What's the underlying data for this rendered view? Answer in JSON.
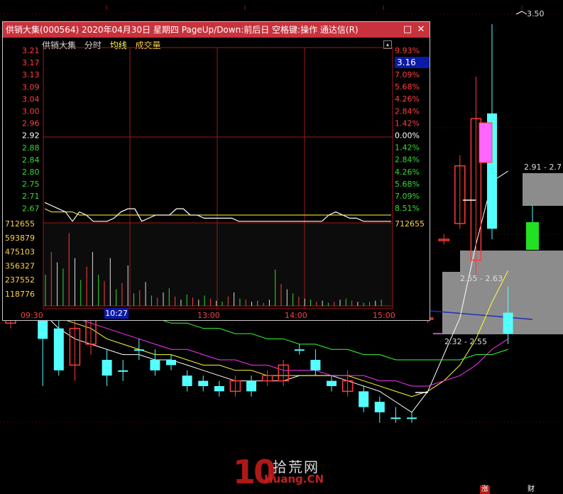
{
  "window": {
    "title": "供销大集(000564) 2020年04月30日 星期四 PageUp/Down:前后日 空格键:操作 通达信(R)",
    "restore_glyph": "□",
    "close_glyph": "✕"
  },
  "menu": {
    "stock_name": "供销大集",
    "items": [
      "分时",
      "均线",
      "成交量"
    ]
  },
  "intraday": {
    "price_labels_left": [
      "3.21",
      "3.17",
      "3.13",
      "3.09",
      "3.04",
      "3.00",
      "2.96",
      "2.92",
      "2.88",
      "2.84",
      "2.80",
      "2.75",
      "2.71",
      "2.67"
    ],
    "pct_labels_right": [
      "9.93%",
      "7.09%",
      "5.68%",
      "4.26%",
      "2.84%",
      "1.42%",
      "0.00%",
      "1.42%",
      "2.84%",
      "4.26%",
      "5.68%",
      "7.09%",
      "8.51%"
    ],
    "volume_labels": [
      "712655",
      "593879",
      "475103",
      "356327",
      "237552",
      "118776"
    ],
    "volume_label_right": "712655",
    "time_labels": [
      "09:30",
      "13:00",
      "14:00",
      "15:00"
    ],
    "cursor_price": "3.16",
    "cursor_time": "10:27",
    "prev_close": 2.92,
    "price_series": [
      2.72,
      2.71,
      2.7,
      2.69,
      2.66,
      2.69,
      2.68,
      2.66,
      2.66,
      2.66,
      2.67,
      2.69,
      2.7,
      2.7,
      2.66,
      2.67,
      2.68,
      2.68,
      2.68,
      2.7,
      2.7,
      2.68,
      2.68,
      2.67,
      2.67,
      2.67,
      2.67,
      2.67,
      2.66,
      2.66,
      2.66,
      2.66,
      2.66,
      2.66,
      2.66,
      2.66,
      2.66,
      2.66,
      2.66,
      2.66,
      2.66,
      2.68,
      2.69,
      2.68,
      2.67,
      2.67,
      2.66,
      2.66,
      2.66,
      2.66,
      2.66
    ],
    "avg_series": [
      2.7,
      2.69,
      2.69,
      2.69,
      2.69,
      2.68,
      2.68,
      2.68,
      2.68,
      2.68,
      2.68,
      2.68,
      2.68,
      2.68,
      2.68,
      2.68,
      2.68,
      2.68,
      2.68,
      2.68,
      2.68,
      2.68,
      2.68,
      2.68,
      2.68,
      2.68,
      2.68,
      2.68,
      2.68,
      2.68,
      2.68,
      2.68,
      2.68,
      2.68,
      2.68,
      2.68,
      2.68,
      2.68,
      2.68,
      2.68,
      2.68,
      2.68,
      2.68,
      2.68,
      2.68,
      2.68,
      2.68,
      2.68,
      2.68,
      2.68,
      2.68
    ]
  },
  "kline": {
    "price_tags": {
      "high": "3.50",
      "range_top": "2.91 - 2.7",
      "range_mid": "2.55 - 2.63",
      "range_low": "2.32 - 2.55"
    },
    "candles": [
      {
        "o": 3.05,
        "c": 2.95,
        "h": 3.08,
        "l": 2.94,
        "up": true
      },
      {
        "o": 3.04,
        "c": 2.98,
        "h": 3.1,
        "l": 2.96,
        "up": false
      },
      {
        "o": 2.96,
        "c": 2.92,
        "h": 2.99,
        "l": 2.83,
        "up": false
      },
      {
        "o": 2.94,
        "c": 2.86,
        "h": 2.97,
        "l": 2.85,
        "up": false
      },
      {
        "o": 2.87,
        "c": 2.94,
        "h": 2.96,
        "l": 2.84,
        "up": true
      },
      {
        "o": 2.91,
        "c": 2.96,
        "h": 2.98,
        "l": 2.89,
        "up": true
      },
      {
        "o": 2.88,
        "c": 2.85,
        "h": 2.9,
        "l": 2.83,
        "up": false
      },
      {
        "o": 2.86,
        "c": 2.86,
        "h": 2.88,
        "l": 2.84,
        "up": false
      },
      {
        "o": 2.9,
        "c": 2.9,
        "h": 2.92,
        "l": 2.88,
        "up": false
      },
      {
        "o": 2.88,
        "c": 2.86,
        "h": 2.9,
        "l": 2.85,
        "up": false
      },
      {
        "o": 2.88,
        "c": 2.87,
        "h": 2.89,
        "l": 2.86,
        "up": false
      },
      {
        "o": 2.85,
        "c": 2.83,
        "h": 2.86,
        "l": 2.82,
        "up": false
      },
      {
        "o": 2.84,
        "c": 2.83,
        "h": 2.85,
        "l": 2.82,
        "up": false
      },
      {
        "o": 2.83,
        "c": 2.82,
        "h": 2.84,
        "l": 2.81,
        "up": false
      },
      {
        "o": 2.82,
        "c": 2.84,
        "h": 2.85,
        "l": 2.81,
        "up": true
      },
      {
        "o": 2.84,
        "c": 2.82,
        "h": 2.85,
        "l": 2.81,
        "up": false
      },
      {
        "o": 2.84,
        "c": 2.85,
        "h": 2.86,
        "l": 2.83,
        "up": true
      },
      {
        "o": 2.84,
        "c": 2.87,
        "h": 2.88,
        "l": 2.83,
        "up": true
      },
      {
        "o": 2.9,
        "c": 2.9,
        "h": 2.91,
        "l": 2.89,
        "up": false
      },
      {
        "o": 2.88,
        "c": 2.86,
        "h": 2.9,
        "l": 2.85,
        "up": false
      },
      {
        "o": 2.84,
        "c": 2.83,
        "h": 2.85,
        "l": 2.82,
        "up": false
      },
      {
        "o": 2.82,
        "c": 2.84,
        "h": 2.86,
        "l": 2.81,
        "up": true
      },
      {
        "o": 2.82,
        "c": 2.79,
        "h": 2.83,
        "l": 2.78,
        "up": false
      },
      {
        "o": 2.8,
        "c": 2.78,
        "h": 2.81,
        "l": 2.76,
        "up": false
      },
      {
        "o": 2.77,
        "c": 2.77,
        "h": 2.79,
        "l": 2.76,
        "up": false
      },
      {
        "o": 2.77,
        "c": 2.77,
        "h": 2.78,
        "l": 2.76,
        "up": false
      },
      {
        "o": 2.96,
        "c": 2.96,
        "h": 2.97,
        "l": 2.95,
        "up": true
      },
      {
        "o": 3.11,
        "c": 3.11,
        "h": 3.12,
        "l": 3.1,
        "up": true
      },
      {
        "o": 3.25,
        "c": 3.14,
        "h": 3.27,
        "l": 3.13,
        "up": true
      },
      {
        "o": 3.07,
        "c": 3.34,
        "h": 3.42,
        "l": 3.04,
        "up": true
      },
      {
        "o": 3.35,
        "c": 3.13,
        "h": 3.52,
        "l": 3.11,
        "up": false
      },
      {
        "o": 2.97,
        "c": 2.93,
        "h": 3.02,
        "l": 2.91,
        "up": false
      }
    ],
    "ma_series": [
      {
        "name": "ma5",
        "color": "#ffffff",
        "values": [
          3.03,
          3.0,
          2.97,
          2.94,
          2.92,
          2.91,
          2.9,
          2.89,
          2.89,
          2.88,
          2.88,
          2.87,
          2.86,
          2.85,
          2.84,
          2.84,
          2.84,
          2.84,
          2.85,
          2.85,
          2.85,
          2.84,
          2.83,
          2.82,
          2.8,
          2.78,
          2.82,
          2.89,
          2.96,
          3.1,
          3.22,
          3.24
        ]
      },
      {
        "name": "ma10",
        "color": "#ffff33",
        "values": [
          3.0,
          2.99,
          2.98,
          2.96,
          2.95,
          2.94,
          2.92,
          2.91,
          2.9,
          2.89,
          2.89,
          2.88,
          2.87,
          2.87,
          2.86,
          2.86,
          2.85,
          2.85,
          2.85,
          2.85,
          2.85,
          2.85,
          2.84,
          2.83,
          2.82,
          2.81,
          2.82,
          2.84,
          2.87,
          2.92,
          2.99,
          3.05
        ]
      },
      {
        "name": "ma20",
        "color": "#ff33ff",
        "values": [
          2.99,
          2.98,
          2.98,
          2.97,
          2.96,
          2.95,
          2.94,
          2.93,
          2.92,
          2.91,
          2.9,
          2.9,
          2.89,
          2.88,
          2.88,
          2.87,
          2.87,
          2.86,
          2.86,
          2.86,
          2.85,
          2.85,
          2.85,
          2.84,
          2.84,
          2.83,
          2.83,
          2.84,
          2.85,
          2.87,
          2.9,
          2.92
        ]
      },
      {
        "name": "ma60",
        "color": "#33ff33",
        "values": [
          3.0,
          3.0,
          2.99,
          2.99,
          2.98,
          2.98,
          2.97,
          2.97,
          2.96,
          2.96,
          2.95,
          2.95,
          2.94,
          2.94,
          2.93,
          2.93,
          2.92,
          2.92,
          2.91,
          2.91,
          2.9,
          2.9,
          2.89,
          2.89,
          2.88,
          2.88,
          2.88,
          2.88,
          2.88,
          2.89,
          2.89,
          2.9
        ]
      }
    ],
    "corner_labels": [
      "涨",
      "财"
    ]
  },
  "watermark": {
    "big": "10",
    "cn": "拾荒网",
    "en": "Huang.CN"
  },
  "colors": {
    "up": "#ff3b3b",
    "down": "#54ffff",
    "grid": "#7a1010",
    "title": "#c8323c"
  }
}
